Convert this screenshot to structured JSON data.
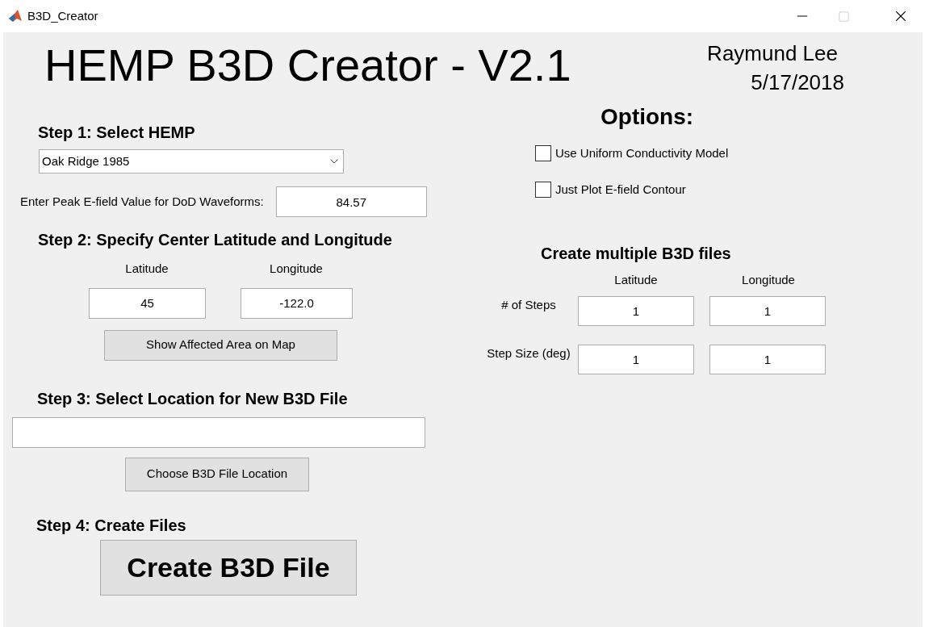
{
  "window": {
    "title": "B3D_Creator"
  },
  "header": {
    "title": "HEMP B3D Creator - V2.1",
    "author": "Raymund Lee",
    "date": "5/17/2018"
  },
  "step1": {
    "heading": "Step 1: Select HEMP",
    "dropdown": "Oak Ridge 1985",
    "peak_label": "Enter Peak E-field Value for DoD Waveforms:",
    "peak_value": "84.57"
  },
  "step2": {
    "heading": "Step 2: Specify Center Latitude and Longitude",
    "latitude_label": "Latitude",
    "longitude_label": "Longitude",
    "latitude": "45",
    "longitude": "-122.0",
    "button": "Show Affected Area on Map"
  },
  "step3": {
    "heading": "Step 3: Select Location for New B3D File",
    "button": "Choose B3D File Location"
  },
  "step4": {
    "heading": "Step 4: Create Files",
    "button": "Create B3D File"
  },
  "options": {
    "heading": "Options:",
    "checkboxes": [
      {
        "label": "Use Uniform Conductivity Model",
        "checked": false
      },
      {
        "label": "Just Plot E-field Contour",
        "checked": false
      }
    ]
  },
  "multiple": {
    "heading": "Create multiple B3D files",
    "columns": [
      "Latitude",
      "Longitude"
    ],
    "rows": [
      {
        "label": "# of Steps",
        "values": [
          "1",
          "1"
        ]
      },
      {
        "label": "Step Size (deg)",
        "values": [
          "1",
          "1"
        ]
      }
    ]
  }
}
